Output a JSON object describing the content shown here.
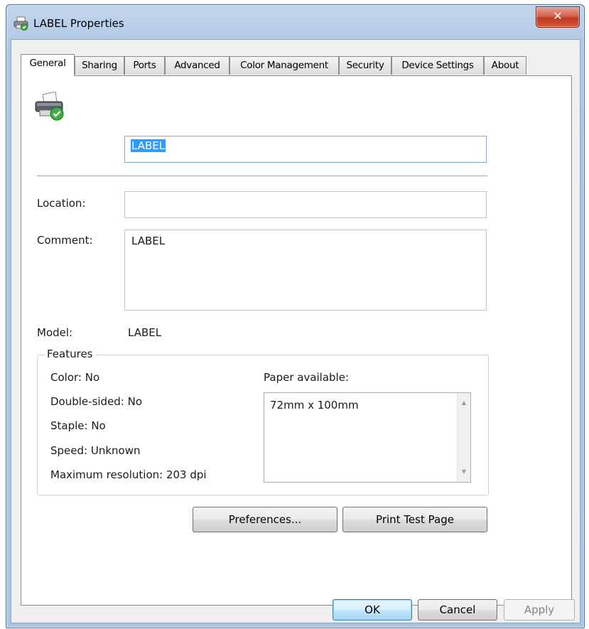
{
  "window": {
    "title": "LABEL Properties"
  },
  "tabs": [
    {
      "label": "General"
    },
    {
      "label": "Sharing"
    },
    {
      "label": "Ports"
    },
    {
      "label": "Advanced"
    },
    {
      "label": "Color Management"
    },
    {
      "label": "Security"
    },
    {
      "label": "Device Settings"
    },
    {
      "label": "About"
    }
  ],
  "active_tab": "General",
  "general": {
    "printer_name": "LABEL",
    "location_label": "Location:",
    "location_value": "",
    "comment_label": "Comment:",
    "comment_value": "LABEL",
    "model_label": "Model:",
    "model_value": "LABEL"
  },
  "features": {
    "title": "Features",
    "color": "Color: No",
    "double_sided": "Double-sided: No",
    "staple": "Staple: No",
    "speed": "Speed: Unknown",
    "max_resolution": "Maximum resolution: 203 dpi",
    "paper_label": "Paper available:",
    "paper_items": [
      "72mm x 100mm"
    ]
  },
  "buttons": {
    "preferences": "Preferences...",
    "print_test_page": "Print Test Page",
    "ok": "OK",
    "cancel": "Cancel",
    "apply": "Apply"
  },
  "icons": {
    "title": "printer-icon",
    "close": "close-icon",
    "printer": "printer-ready-icon"
  },
  "colors": {
    "selection": "#3399ff",
    "default_button_border": "#3c7fb1",
    "close_button": "#c0391f"
  }
}
